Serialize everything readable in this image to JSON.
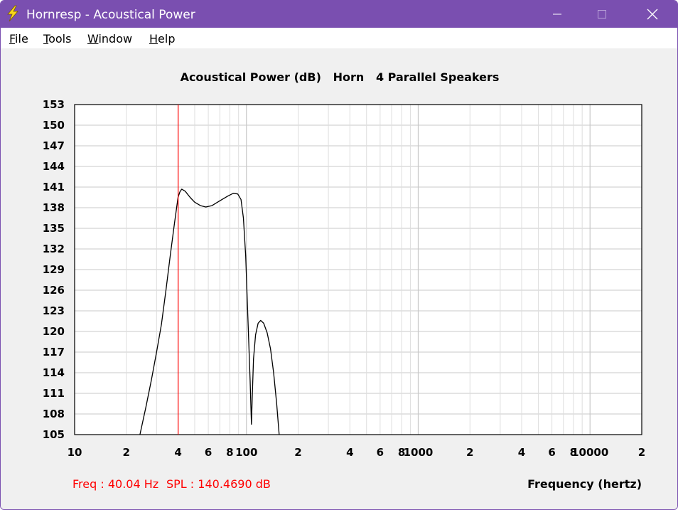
{
  "window": {
    "title": "Hornresp - Acoustical Power",
    "icon": "lightning-icon",
    "controls": [
      "minimize-icon",
      "maximize-icon",
      "close-icon"
    ]
  },
  "menu": [
    {
      "mnemonic": "F",
      "rest": "ile"
    },
    {
      "mnemonic": "T",
      "rest": "ools"
    },
    {
      "mnemonic": "W",
      "rest": "indow"
    },
    {
      "mnemonic": "H",
      "rest": "elp"
    }
  ],
  "chart_data": {
    "type": "line",
    "title": "Acoustical Power (dB)   Horn   4 Parallel Speakers",
    "xlabel": "Frequency (hertz)",
    "ylabel": "",
    "x_scale": "log",
    "xlim": [
      10,
      20000
    ],
    "ylim": [
      105,
      153
    ],
    "y_ticks": [
      "153",
      "150",
      "147",
      "144",
      "141",
      "138",
      "135",
      "132",
      "129",
      "126",
      "123",
      "120",
      "117",
      "114",
      "111",
      "108",
      "105"
    ],
    "x_tick_labels": [
      {
        "x": 10,
        "label": "10"
      },
      {
        "x": 20,
        "label": "2"
      },
      {
        "x": 40,
        "label": "4"
      },
      {
        "x": 60,
        "label": "6"
      },
      {
        "x": 80,
        "label": "8"
      },
      {
        "x": 100,
        "label": "100"
      },
      {
        "x": 200,
        "label": "2"
      },
      {
        "x": 400,
        "label": "4"
      },
      {
        "x": 600,
        "label": "6"
      },
      {
        "x": 800,
        "label": "8"
      },
      {
        "x": 1000,
        "label": "1000"
      },
      {
        "x": 2000,
        "label": "2"
      },
      {
        "x": 4000,
        "label": "4"
      },
      {
        "x": 6000,
        "label": "6"
      },
      {
        "x": 8000,
        "label": "8"
      },
      {
        "x": 10000,
        "label": "10000"
      },
      {
        "x": 20000,
        "label": "2"
      }
    ],
    "grid": true,
    "series": [
      {
        "color": "#000000",
        "points": [
          [
            24,
            105
          ],
          [
            26,
            109
          ],
          [
            28,
            113
          ],
          [
            30,
            117
          ],
          [
            32,
            121
          ],
          [
            34,
            126
          ],
          [
            36,
            131
          ],
          [
            38,
            135.5
          ],
          [
            40,
            139.5
          ],
          [
            41,
            140.3
          ],
          [
            42,
            140.7
          ],
          [
            44,
            140.4
          ],
          [
            47,
            139.5
          ],
          [
            50,
            138.8
          ],
          [
            54,
            138.3
          ],
          [
            58,
            138.1
          ],
          [
            63,
            138.3
          ],
          [
            70,
            139
          ],
          [
            78,
            139.7
          ],
          [
            84,
            140.1
          ],
          [
            89,
            140.0
          ],
          [
            93,
            139.2
          ],
          [
            96,
            136.5
          ],
          [
            99,
            131
          ],
          [
            102,
            122
          ],
          [
            105,
            113
          ],
          [
            107,
            106.5
          ],
          [
            108,
            110
          ],
          [
            110,
            116
          ],
          [
            113,
            119.5
          ],
          [
            117,
            121.2
          ],
          [
            121,
            121.6
          ],
          [
            126,
            121.2
          ],
          [
            132,
            119.8
          ],
          [
            138,
            117.5
          ],
          [
            144,
            114
          ],
          [
            150,
            109.5
          ],
          [
            155,
            105
          ]
        ]
      }
    ],
    "marker": {
      "x": 40.04,
      "color": "#ff0000"
    },
    "readout": {
      "freq": "Freq : 40.04 Hz",
      "spl": "SPL : 140.4690 dB",
      "color": "#ff0000"
    }
  }
}
